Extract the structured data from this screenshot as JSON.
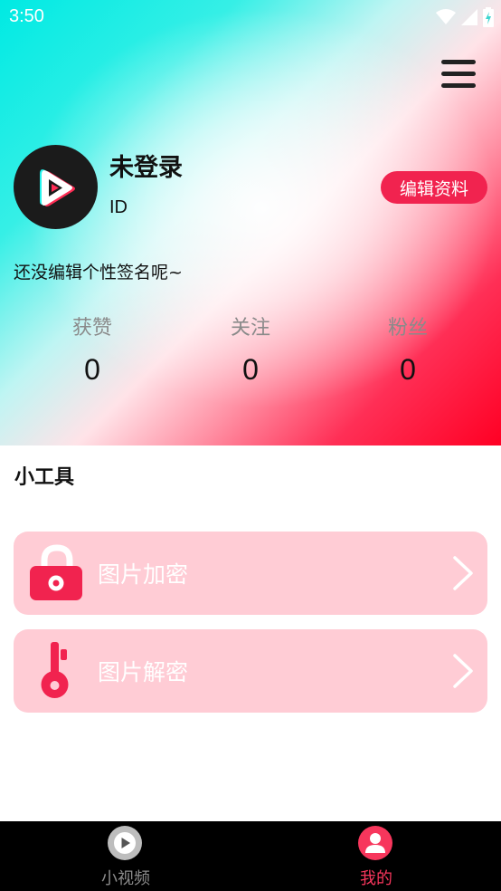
{
  "status_bar": {
    "time": "3:50"
  },
  "profile": {
    "name": "未登录",
    "id_label": "ID",
    "edit_button": "编辑资料",
    "signature": "还没编辑个性签名呢~"
  },
  "stats": [
    {
      "label": "获赞",
      "value": "0"
    },
    {
      "label": "关注",
      "value": "0"
    },
    {
      "label": "粉丝",
      "value": "0"
    }
  ],
  "tools": {
    "title": "小工具",
    "items": [
      {
        "label": "图片加密",
        "icon": "lock-icon"
      },
      {
        "label": "图片解密",
        "icon": "key-icon"
      }
    ]
  },
  "bottom_nav": {
    "items": [
      {
        "label": "小视频",
        "icon": "play-icon",
        "active": false
      },
      {
        "label": "我的",
        "icon": "user-icon",
        "active": true
      }
    ]
  },
  "colors": {
    "accent": "#f1234f",
    "card_bg": "#ffccd5",
    "nav_active": "#f7365c",
    "nav_inactive": "#8c8c8c"
  }
}
